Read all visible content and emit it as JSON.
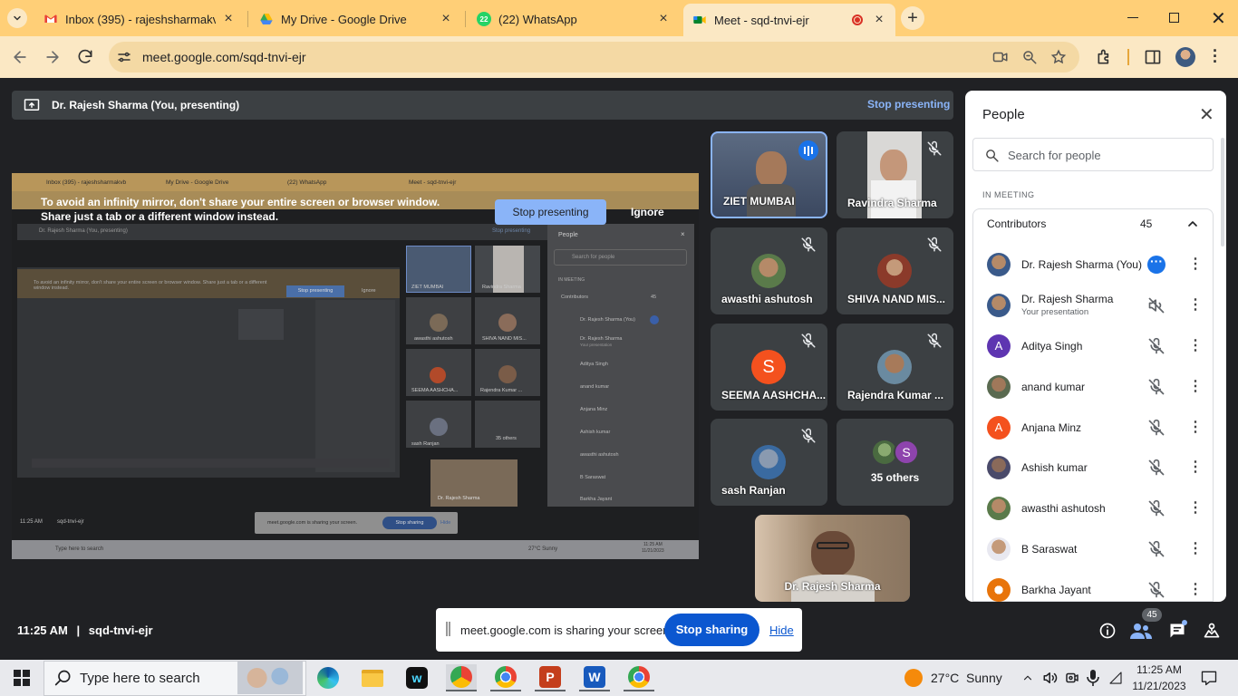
{
  "browser": {
    "tabs": [
      {
        "title": "Inbox (395) - rajeshsharmakvb",
        "icon": "gmail-icon"
      },
      {
        "title": "My Drive - Google Drive",
        "icon": "google-drive-icon"
      },
      {
        "title": "(22) WhatsApp",
        "icon": "whatsapp-icon"
      },
      {
        "title": "Meet - sqd-tnvi-ejr",
        "icon": "google-meet-icon",
        "active": true
      }
    ],
    "url": "meet.google.com/sqd-tnvi-ejr",
    "accent": "#ffcf77"
  },
  "meet": {
    "presenting_label": "Dr. Rajesh Sharma (You, presenting)",
    "stop_presenting_top": "Stop presenting",
    "warning_text": "To avoid an infinity mirror, don't share your entire screen or browser window. Share just a tab or a different window instead.",
    "stop_presenting_button": "Stop presenting",
    "ignore_button": "Ignore",
    "tiles": [
      {
        "name": "ZIET MUMBAI",
        "speaking": true
      },
      {
        "name": "Ravindra Sharma"
      },
      {
        "name": "awasthi ashutosh"
      },
      {
        "name": "SHIVA NAND MIS..."
      },
      {
        "name": "SEEMA AASHCHA...",
        "initial": "S",
        "color": "#f4511e"
      },
      {
        "name": "Rajendra Kumar ..."
      },
      {
        "name": "sash Ranjan"
      },
      {
        "name": "35 others",
        "initial": "S",
        "color": "#8e44ad"
      }
    ],
    "self_tile_name": "Dr. Rajesh Sharma",
    "time": "11:25 AM",
    "separator": "|",
    "meeting_code": "sqd-tnvi-ejr",
    "share_bar": {
      "text": "meet.google.com is sharing your screen.",
      "stop": "Stop sharing",
      "hide": "Hide"
    },
    "people_badge": "45",
    "mini": {
      "tabs": [
        "Inbox (395) - rajeshsharmakvb",
        "My Drive - Google Drive",
        "(22) WhatsApp",
        "Meet - sqd-tnvi-ejr"
      ],
      "presenting": "Dr. Rajesh Sharma (You, presenting)",
      "stop_top": "Stop presenting",
      "warning": "To avoid an infinity mirror, don't share your entire screen or browser window. Share just a tab or a different window instead.",
      "stop_btn": "Stop presenting",
      "ignore": "Ignore",
      "tile_names": [
        "ZIET MUMBAI",
        "Ravindra Sharma",
        "awasthi ashutosh",
        "SHIVA NAND MIS...",
        "SEEMA AASHCHA...",
        "Rajendra Kumar ...",
        "sash Ranjan",
        "35 others",
        "Dr. Rajesh Sharma"
      ],
      "people_title": "People",
      "search": "Search for people",
      "in_meeting": "IN MEETING",
      "contributors": "Contributors",
      "count": "45",
      "names": [
        "Dr. Rajesh Sharma (You)",
        "Dr. Rajesh Sharma",
        "Aditya Singh",
        "anand kumar",
        "Anjana Minz",
        "Ashish kumar",
        "awasthi ashutosh",
        "B Saraswat",
        "Barkha Jayant"
      ],
      "sub": "Your presentation",
      "time": "11:25 AM",
      "code": "sqd-tnvi-ejr",
      "share_text": "meet.google.com is sharing your screen.",
      "share_stop": "Stop sharing",
      "share_hide": "Hide",
      "task_search": "Type here to search",
      "weather": "27°C  Sunny",
      "clock_time": "11:25 AM",
      "clock_date": "11/21/2023"
    }
  },
  "people_panel": {
    "title": "People",
    "search_placeholder": "Search for people",
    "section": "IN MEETING",
    "group_label": "Contributors",
    "count": "45",
    "participants": [
      {
        "name": "Dr. Rajesh Sharma (You)",
        "status": "more"
      },
      {
        "name": "Dr. Rajesh Sharma",
        "sub": "Your presentation",
        "status": "sound-off"
      },
      {
        "name": "Aditya Singh",
        "initial": "A",
        "color": "#5e35b1",
        "status": "muted"
      },
      {
        "name": "anand kumar",
        "status": "muted"
      },
      {
        "name": "Anjana Minz",
        "initial": "A",
        "color": "#f4511e",
        "status": "muted"
      },
      {
        "name": "Ashish kumar",
        "status": "muted"
      },
      {
        "name": "awasthi ashutosh",
        "status": "muted"
      },
      {
        "name": "B Saraswat",
        "status": "muted"
      },
      {
        "name": "Barkha Jayant",
        "status": "muted"
      }
    ]
  },
  "taskbar": {
    "search_placeholder": "Type here to search",
    "weather": "27°C  Sunny",
    "time": "11:25 AM",
    "date": "11/21/2023"
  }
}
